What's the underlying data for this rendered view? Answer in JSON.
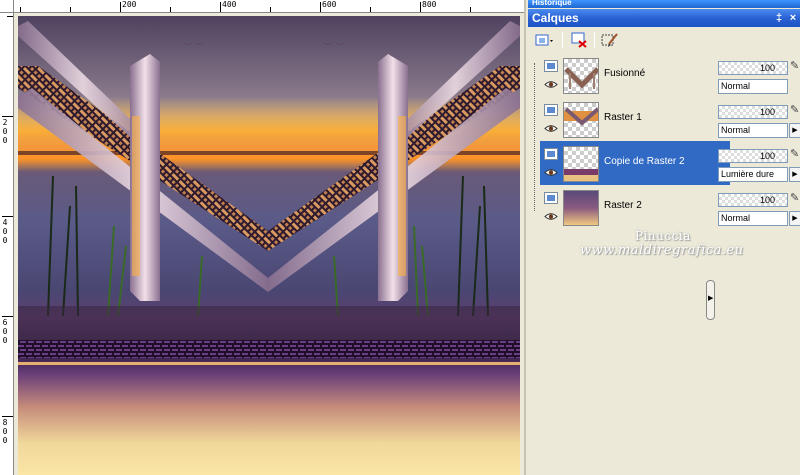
{
  "top_strip": {
    "label": "Historique"
  },
  "ruler_top": [
    "200",
    "400",
    "600",
    "800"
  ],
  "ruler_left": [
    "2",
    "0",
    "0",
    "4",
    "0",
    "0",
    "6",
    "0",
    "0",
    "8",
    "0",
    "0"
  ],
  "panel": {
    "title": "Calques",
    "pin_symbol": "‡",
    "close_symbol": "×"
  },
  "toolbar": {
    "new_layer_icon": "new-layer-icon",
    "delete_layer_icon": "delete-layer-icon",
    "edit_mask_icon": "edit-selection-icon"
  },
  "layers": [
    {
      "name": "Fusionné",
      "opacity": "100",
      "blend": "Normal",
      "selected": false
    },
    {
      "name": "Raster 1",
      "opacity": "100",
      "blend": "Normal",
      "selected": false
    },
    {
      "name": "Copie de Raster 2",
      "opacity": "100",
      "blend": "Lumière dure",
      "selected": true
    },
    {
      "name": "Raster 2",
      "opacity": "100",
      "blend": "Normal",
      "selected": false
    }
  ],
  "watermark": {
    "line1": "Pinuccia",
    "line2": "www.maldiregrafica.eu"
  },
  "colors": {
    "title_blue": "#2a62d4",
    "selection_blue": "#316ac5",
    "panel_bg": "#ece9d8"
  }
}
